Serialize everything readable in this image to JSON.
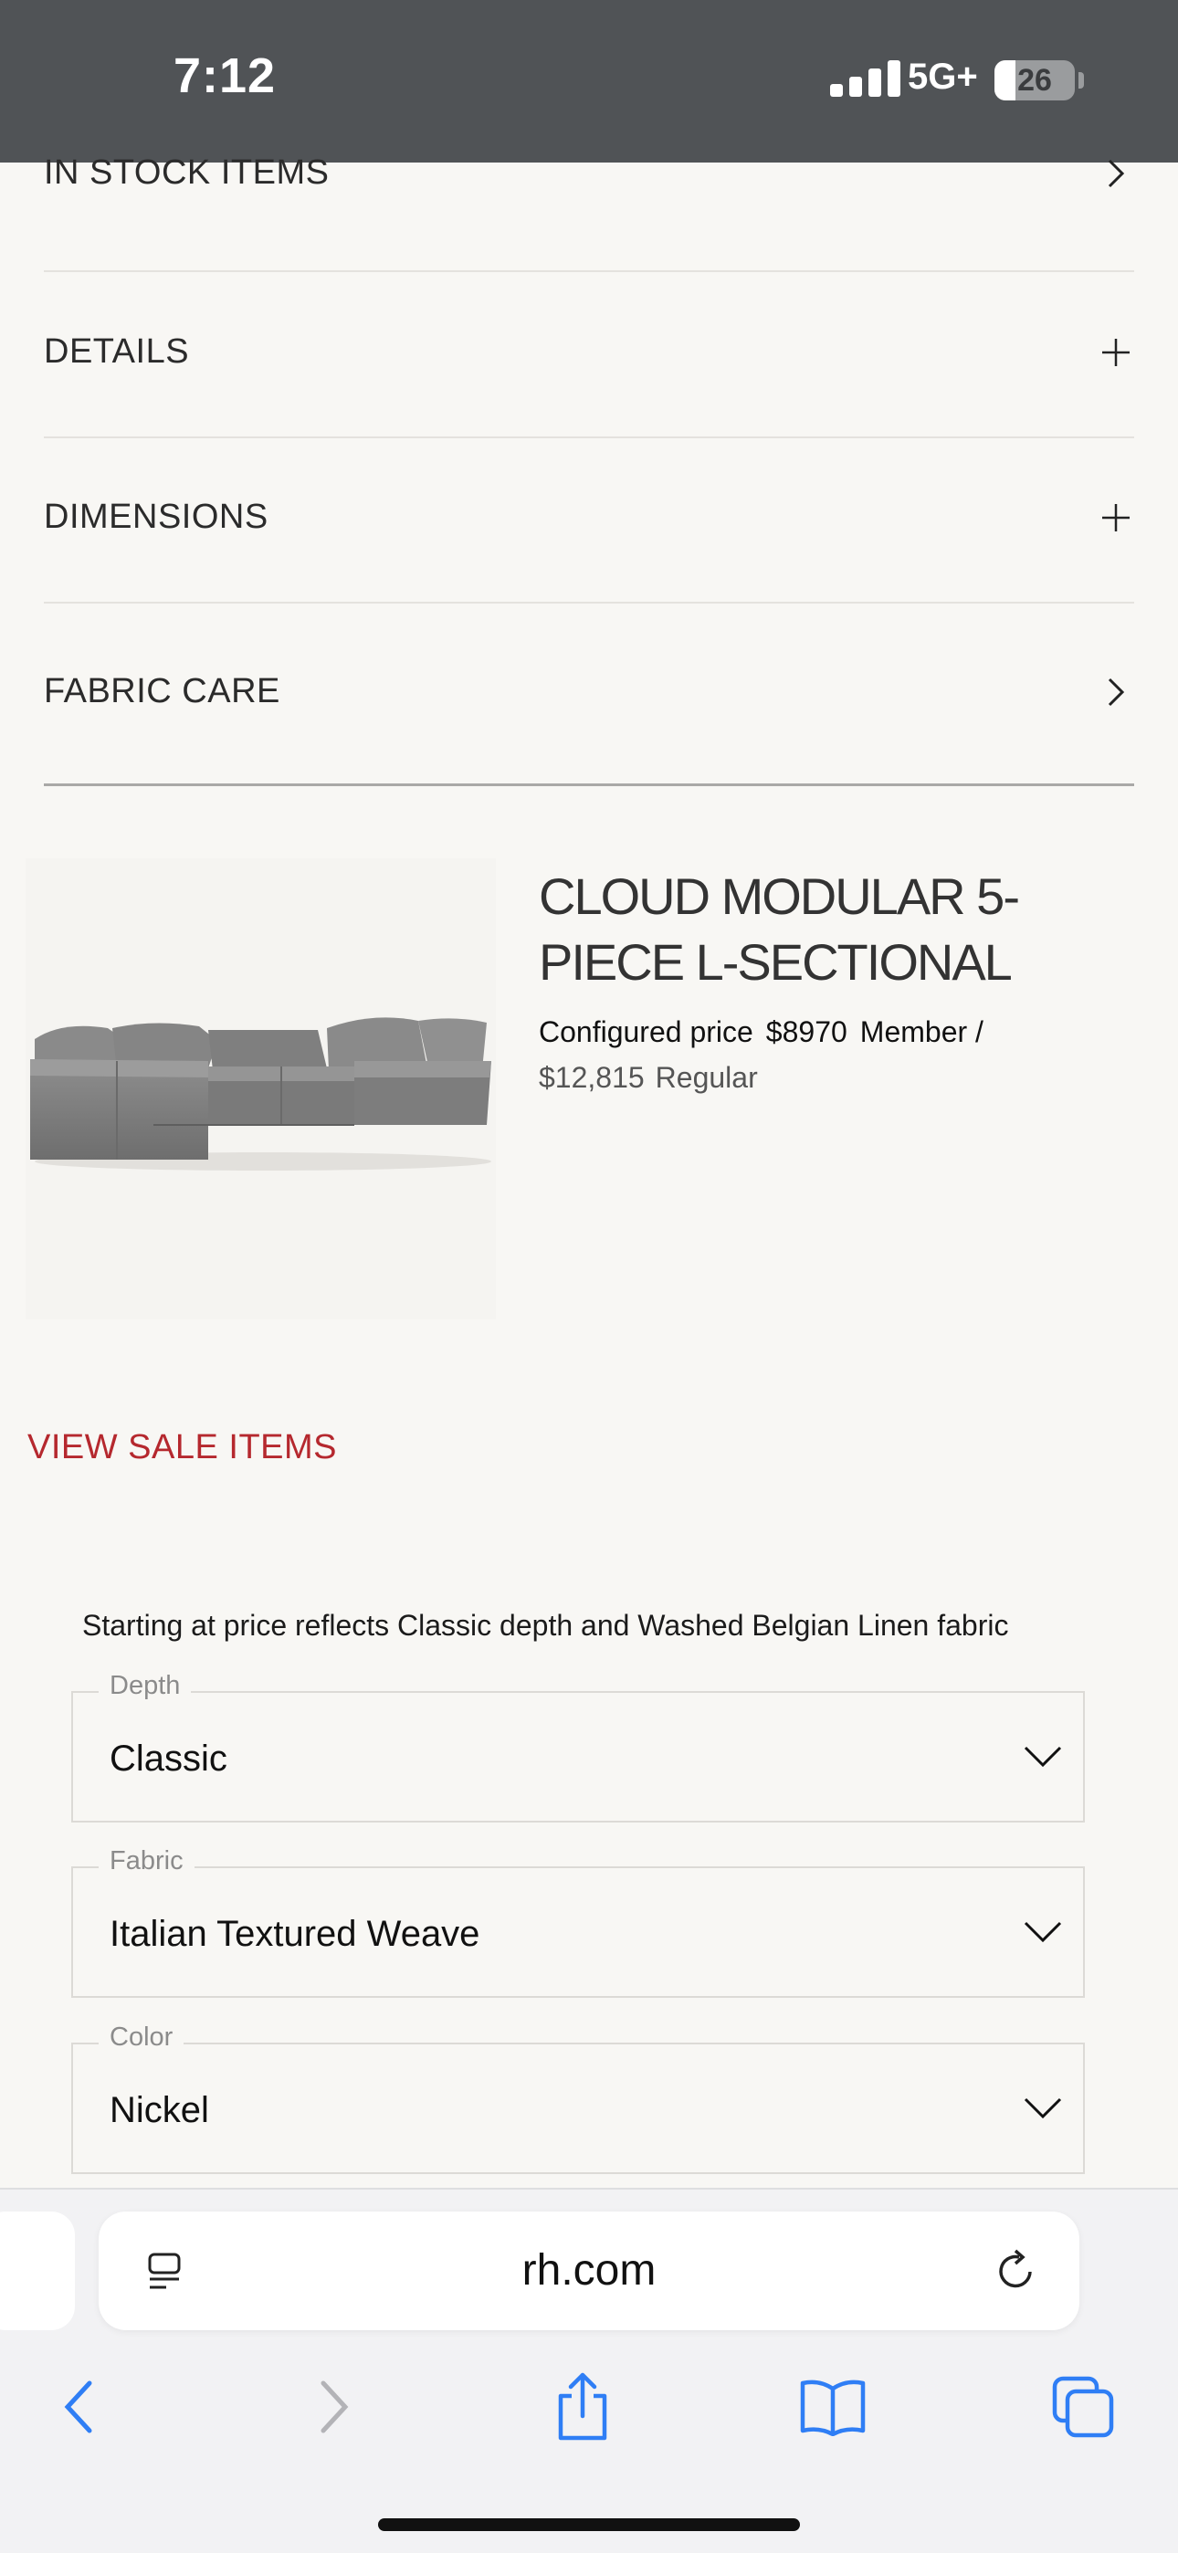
{
  "status_bar": {
    "time": "7:12",
    "network": "5G+",
    "battery_level": "26",
    "battery_fraction": 0.26
  },
  "accordion": [
    {
      "label": "IN STOCK ITEMS",
      "icon": "chevron-right-icon"
    },
    {
      "label": "DETAILS",
      "icon": "plus-icon"
    },
    {
      "label": "DIMENSIONS",
      "icon": "plus-icon"
    },
    {
      "label": "FABRIC CARE",
      "icon": "chevron-right-icon"
    }
  ],
  "product": {
    "title": "CLOUD MODULAR 5-PIECE L-SECTIONAL",
    "configured_label": "Configured price",
    "member_price": "$8970",
    "member_label": "Member /",
    "regular_price": "$12,815",
    "regular_label": "Regular",
    "image": "sectional-sofa-image"
  },
  "sale_link": "VIEW SALE ITEMS",
  "options": {
    "note": "Starting at price reflects Classic depth and Washed Belgian Linen fabric",
    "selects": [
      {
        "label": "Depth",
        "value": "Classic"
      },
      {
        "label": "Fabric",
        "value": "Italian Textured Weave"
      },
      {
        "label": "Color",
        "value": "Nickel"
      }
    ]
  },
  "browser": {
    "url": "rh.com",
    "accent_color": "#2f7ef5",
    "disabled_color": "#b3b3b7",
    "buttons": [
      "back-icon",
      "forward-icon",
      "share-icon",
      "bookmarks-icon",
      "tabs-icon"
    ]
  }
}
